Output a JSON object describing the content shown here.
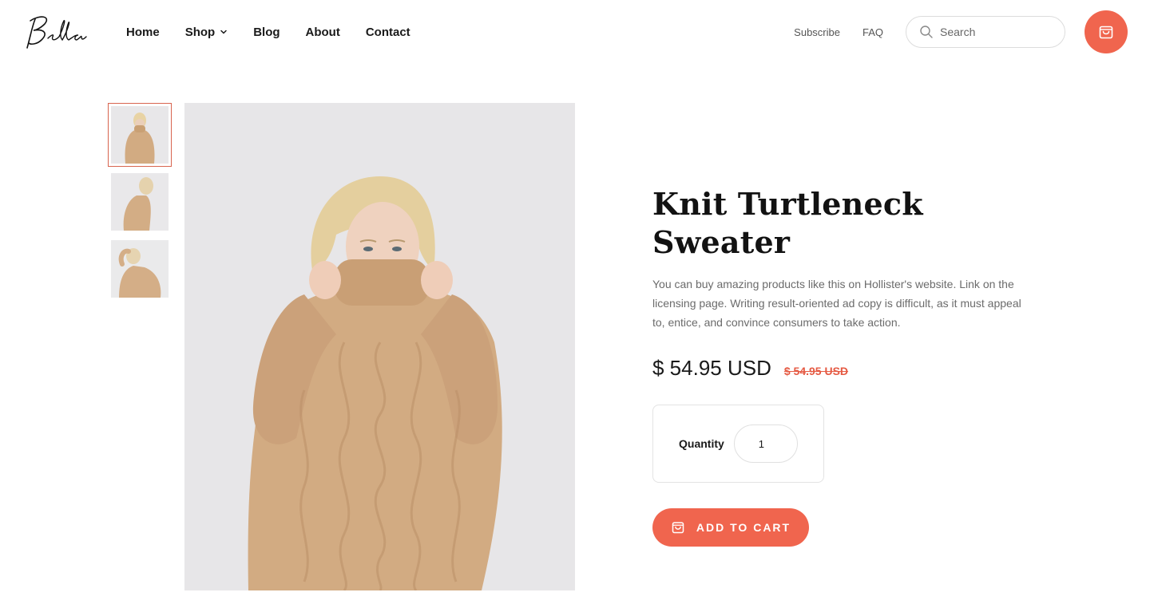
{
  "brand": {
    "logo_text": "Bella"
  },
  "nav": {
    "items": [
      {
        "label": "Home"
      },
      {
        "label": "Shop"
      },
      {
        "label": "Blog"
      },
      {
        "label": "About"
      },
      {
        "label": "Contact"
      }
    ]
  },
  "header": {
    "subscribe_label": "Subscribe",
    "faq_label": "FAQ",
    "search_placeholder": "Search"
  },
  "gallery": {
    "thumbnails": [
      {
        "alt": "sweater-front"
      },
      {
        "alt": "sweater-side"
      },
      {
        "alt": "sweater-pose"
      }
    ],
    "active_index": 0
  },
  "product": {
    "title": "Knit Turtleneck Sweater",
    "description": "You can buy amazing products like this on Hollister's website. Link on the licensing page. Writing result-oriented ad copy is difficult, as it must appeal to, entice, and convince consumers to take action.",
    "price": "$ 54.95 USD",
    "old_price": "$ 54.95 USD",
    "quantity_label": "Quantity",
    "quantity_value": "1",
    "add_to_cart_label": "ADD TO CART"
  },
  "colors": {
    "accent": "#f0654e",
    "strike_price": "#e55a43",
    "image_bg": "#e7e6e8",
    "sweater": "#d2ab82"
  },
  "icons": {
    "search": "search-icon",
    "cart": "shopping-bag-icon",
    "chevron": "chevron-down-icon"
  }
}
